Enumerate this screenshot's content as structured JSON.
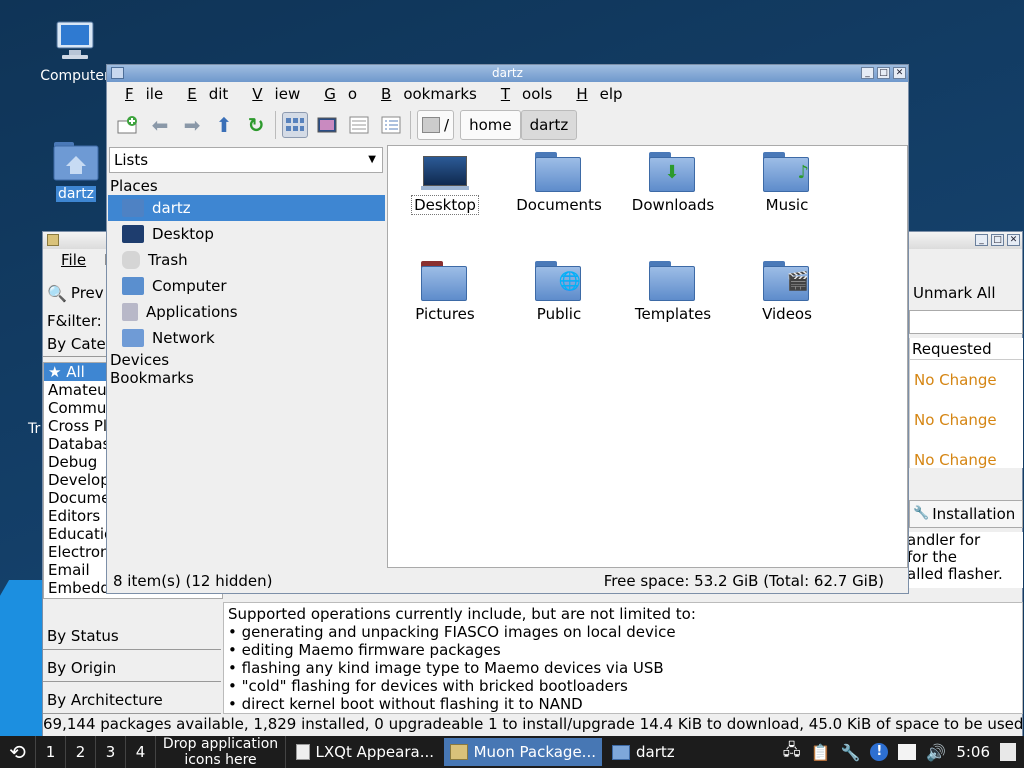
{
  "desktop": {
    "icons": [
      {
        "label": "Computer",
        "icon": "computer-icon"
      },
      {
        "label": "dartz",
        "icon": "home-folder-icon"
      }
    ],
    "trash_fragment": "Tr"
  },
  "muon": {
    "menu": [
      "File",
      "Ed"
    ],
    "preview_label": "Prev",
    "filter_label": "F&ilter:",
    "by_category": "By Cate",
    "categories": [
      "All",
      "Amateu",
      "Commu",
      "Cross Pl",
      "Databas",
      "Debug",
      "Develop",
      "Docume",
      "Editors",
      "Educatio",
      "Electron",
      "Email",
      "Embedded Devices"
    ],
    "filters": [
      "By Status",
      "By Origin",
      "By Architecture"
    ],
    "unmark_all": "Unmark All",
    "requested_header": "Requested",
    "requested_values": [
      "No Change",
      "No Change",
      "No Change"
    ],
    "installation_tab": "Installation",
    "desc_fragments": [
      "andler for",
      "for the",
      "alled flasher."
    ],
    "description": [
      "Supported operations currently include, but are not limited to:",
      "• generating and unpacking FIASCO images on local device",
      "• editing Maemo firmware packages",
      "• flashing any kind image type to Maemo devices via USB",
      "• \"cold\" flashing for devices with bricked bootloaders",
      "• direct kernel boot without flashing it to NAND"
    ],
    "status": "69,144 packages available, 1,829 installed, 0 upgradeable 1 to install/upgrade 14.4 KiB to download, 45.0 KiB of space to be used"
  },
  "fm": {
    "title": "dartz",
    "menu": [
      {
        "pre": "",
        "u": "F",
        "post": "ile"
      },
      {
        "pre": "",
        "u": "E",
        "post": "dit"
      },
      {
        "pre": "",
        "u": "V",
        "post": "iew"
      },
      {
        "pre": "",
        "u": "G",
        "post": "o"
      },
      {
        "pre": "",
        "u": "B",
        "post": "ookmarks"
      },
      {
        "pre": "",
        "u": "T",
        "post": "ools"
      },
      {
        "pre": "",
        "u": "H",
        "post": "elp"
      }
    ],
    "path": [
      "/",
      "home",
      "dartz"
    ],
    "lists_label": "Lists",
    "places_header": "Places",
    "places": [
      {
        "label": "dartz",
        "icon": "home-folder-icon",
        "color": "#4e82c4"
      },
      {
        "label": "Desktop",
        "icon": "desktop-icon",
        "color": "#1e3d6e"
      },
      {
        "label": "Trash",
        "icon": "trash-icon",
        "color": "#c8c8c8"
      },
      {
        "label": "Computer",
        "icon": "computer-icon",
        "color": "#5a8fcf"
      },
      {
        "label": "Applications",
        "icon": "applications-icon",
        "color": "#b0b0b0"
      },
      {
        "label": "Network",
        "icon": "network-icon",
        "color": "#6f9bd6"
      }
    ],
    "devices_header": "Devices",
    "bookmarks_header": "Bookmarks",
    "items": [
      {
        "label": "Desktop",
        "icon": "desktop-folder-icon",
        "emblem": ""
      },
      {
        "label": "Documents",
        "icon": "documents-folder-icon",
        "emblem": ""
      },
      {
        "label": "Downloads",
        "icon": "downloads-folder-icon",
        "emblem": "⬇"
      },
      {
        "label": "Music",
        "icon": "music-folder-icon",
        "emblem": "♪"
      },
      {
        "label": "Pictures",
        "icon": "pictures-folder-icon",
        "emblem": ""
      },
      {
        "label": "Public",
        "icon": "public-folder-icon",
        "emblem": "🌐"
      },
      {
        "label": "Templates",
        "icon": "templates-folder-icon",
        "emblem": ""
      },
      {
        "label": "Videos",
        "icon": "videos-folder-icon",
        "emblem": "🎬"
      }
    ],
    "status_left": "8 item(s) (12 hidden)",
    "status_right": "Free space: 53.2 GiB (Total: 62.7 GiB)"
  },
  "taskbar": {
    "desktops": [
      "1",
      "2",
      "3",
      "4"
    ],
    "quicklaunch": [
      "Drop application",
      "icons here"
    ],
    "tasks": [
      {
        "label": "LXQt Appeara...",
        "icon": "appearance-icon"
      },
      {
        "label": "Muon Package...",
        "icon": "muon-icon"
      },
      {
        "label": "dartz",
        "icon": "folder-icon"
      }
    ],
    "clock": "5:06"
  }
}
